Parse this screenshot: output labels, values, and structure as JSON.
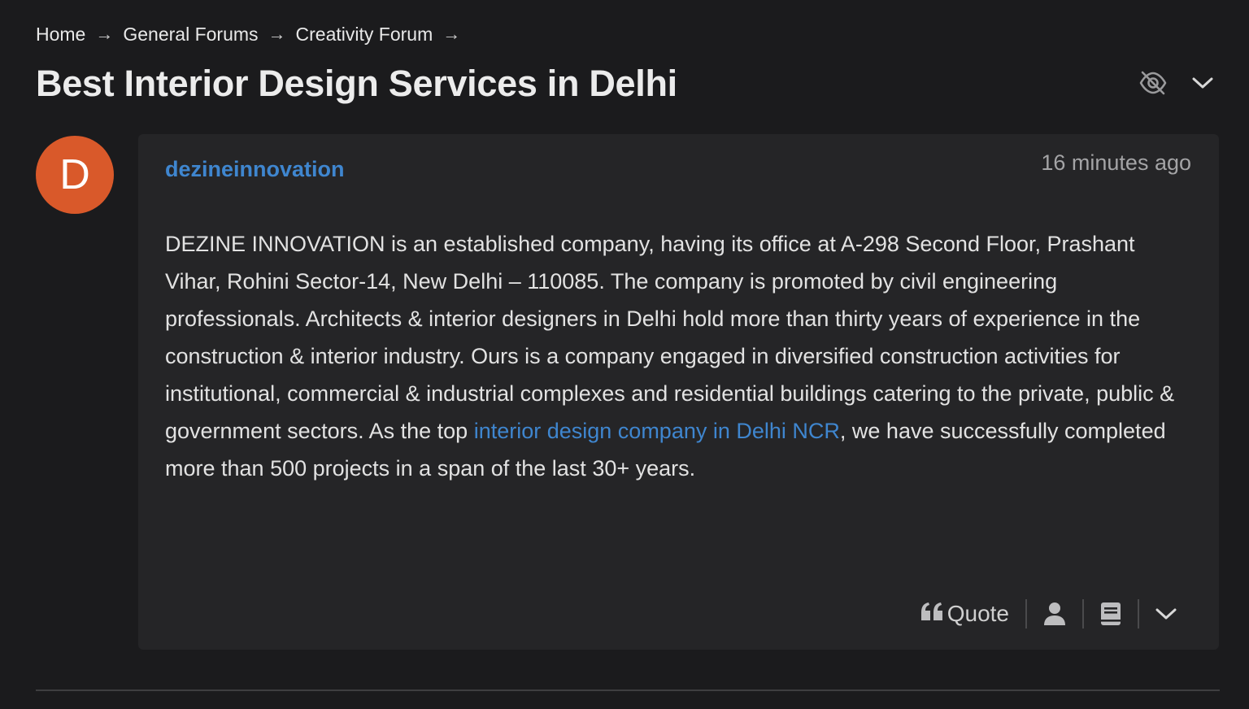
{
  "breadcrumb": {
    "items": [
      {
        "label": "Home"
      },
      {
        "label": "General Forums"
      },
      {
        "label": "Creativity Forum"
      }
    ],
    "separator": "→"
  },
  "topic": {
    "title": "Best Interior Design Services in Delhi",
    "actions": [
      {
        "icon": "eye-slash-icon"
      },
      {
        "icon": "chevron-down-icon"
      }
    ]
  },
  "post": {
    "avatar_letter": "D",
    "avatar_color": "#d9592a",
    "author": "dezineinnovation",
    "timestamp": "16 minutes ago",
    "body_before_link": "DEZINE INNOVATION is an established company, having its office at A-298 Second Floor, Prashant Vihar, Rohini Sector-14, New Delhi – 110085. The company is promoted by civil engineering professionals. Architects & interior designers in Delhi hold more than thirty years of experience in the construction & interior industry. Ours is a company engaged in diversified construction activities for institutional, commercial & industrial complexes and residential buildings catering to the private, public & government sectors. As the top ",
    "body_link": "interior design company in Delhi NCR",
    "body_after_link": ", we have successfully completed more than 500 projects in a span of the last 30+ years.",
    "actions": {
      "quote_label": "Quote",
      "quote_icon": "quote-icon",
      "user_icon": "user-icon",
      "book_icon": "book-icon",
      "more_icon": "chevron-down-icon"
    }
  },
  "colors": {
    "background": "#1b1b1d",
    "card": "#252527",
    "link": "#3f86cf",
    "muted": "#a4a4a6"
  }
}
